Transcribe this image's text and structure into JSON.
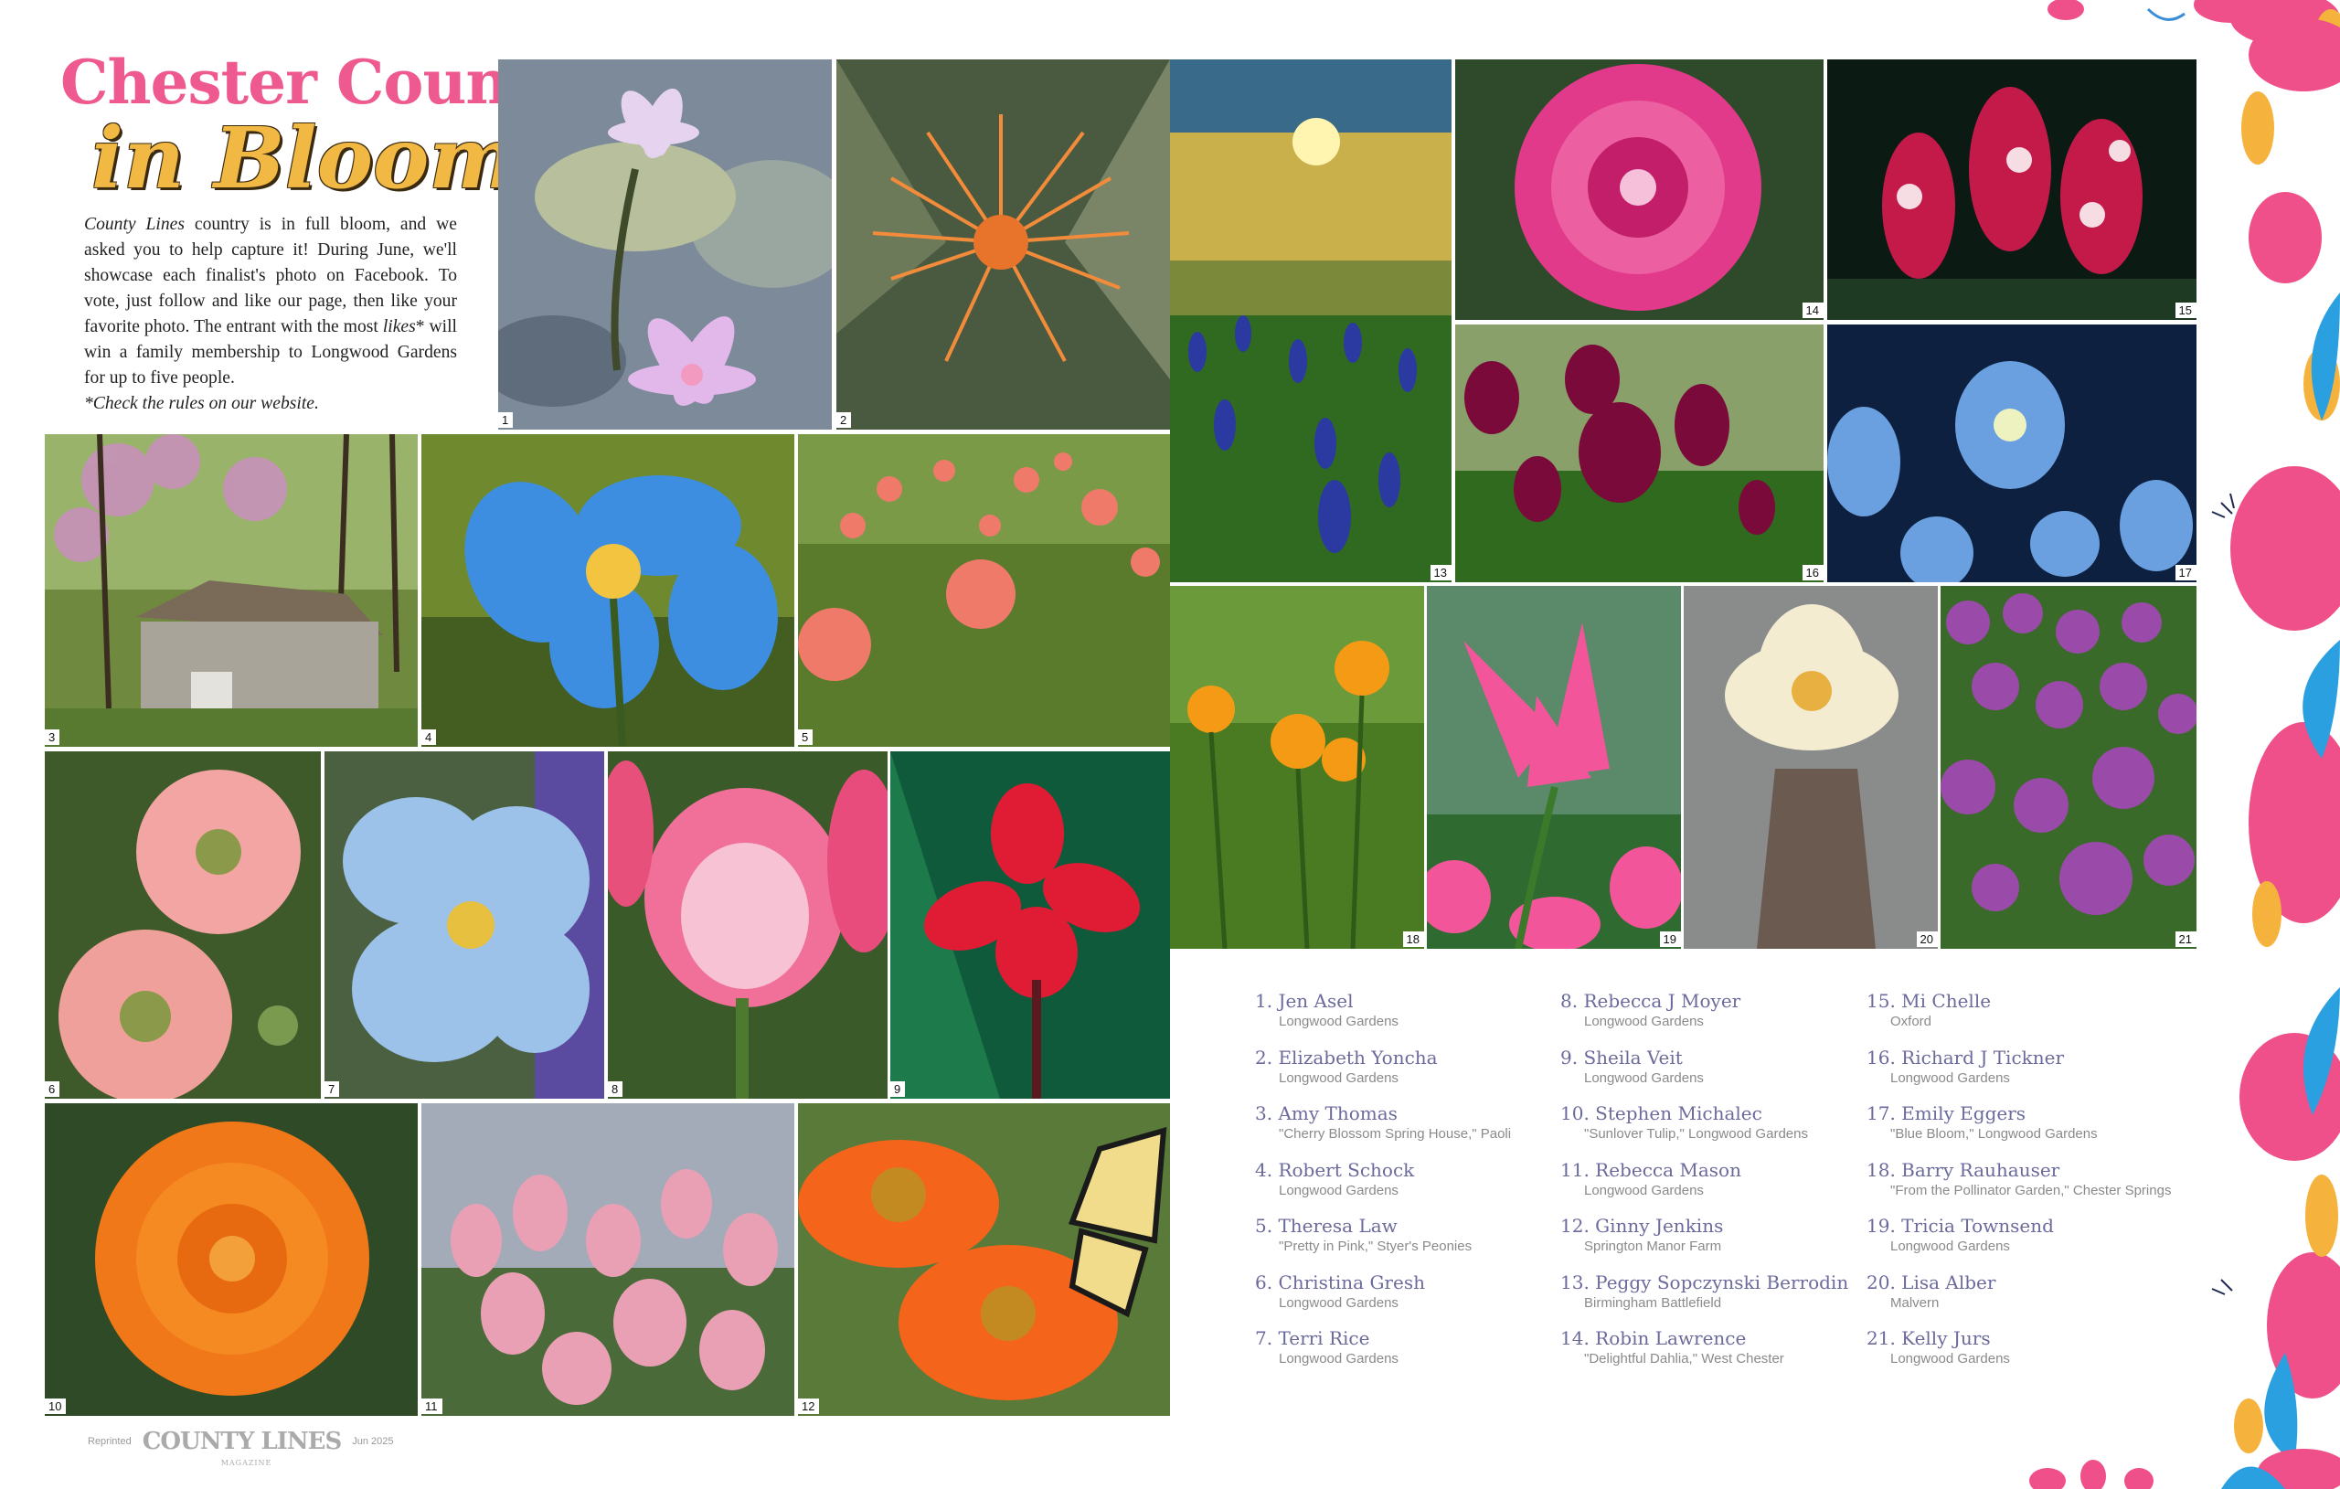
{
  "title": {
    "line1": "Chester County",
    "line2": "in Bloom"
  },
  "intro": {
    "magazine_name": "County Lines",
    "body": " country is in full bloom, and we asked you to help capture it! During June, we'll showcase each finalist's photo on Facebook. To vote, just follow and like our page, then like your favorite photo. The entrant with the most ",
    "likes_word": "likes",
    "body_end": "* will win a family membership to Longwood Gardens for up to five people.",
    "rules_note": "*Check the rules on our website."
  },
  "photos": [
    {
      "number": "1",
      "subject": "water lilies"
    },
    {
      "number": "2",
      "subject": "orange pincushion protea"
    },
    {
      "number": "3",
      "subject": "spring house with redbud trees"
    },
    {
      "number": "4",
      "subject": "blue poppy"
    },
    {
      "number": "5",
      "subject": "coral peonies"
    },
    {
      "number": "6",
      "subject": "pink poppies"
    },
    {
      "number": "7",
      "subject": "blue poppy"
    },
    {
      "number": "8",
      "subject": "fringed pink tulip"
    },
    {
      "number": "9",
      "subject": "red canna lily"
    },
    {
      "number": "10",
      "subject": "orange ranunculus"
    },
    {
      "number": "11",
      "subject": "pink tulips"
    },
    {
      "number": "12",
      "subject": "orange flowers with swallowtail butterfly"
    },
    {
      "number": "13",
      "subject": "sunflower field with grape hyacinths"
    },
    {
      "number": "14",
      "subject": "pink dahlia"
    },
    {
      "number": "15",
      "subject": "snapdragons"
    },
    {
      "number": "16",
      "subject": "burgundy tulips"
    },
    {
      "number": "17",
      "subject": "blue delphinium"
    },
    {
      "number": "18",
      "subject": "orange coreopsis"
    },
    {
      "number": "19",
      "subject": "pink lily tulip"
    },
    {
      "number": "20",
      "subject": "white dahlia over tattooed arm"
    },
    {
      "number": "21",
      "subject": "purple double tulips"
    }
  ],
  "credits": [
    [
      {
        "name": "1. Jen Asel",
        "location": "Longwood Gardens"
      },
      {
        "name": "2. Elizabeth Yoncha",
        "location": "Longwood Gardens"
      },
      {
        "name": "3. Amy Thomas",
        "location": "\"Cherry Blossom Spring House,\" Paoli"
      },
      {
        "name": "4. Robert Schock",
        "location": "Longwood Gardens"
      },
      {
        "name": "5. Theresa Law",
        "location": "\"Pretty in Pink,\" Styer's Peonies"
      },
      {
        "name": "6. Christina Gresh",
        "location": "Longwood Gardens"
      },
      {
        "name": "7. Terri Rice",
        "location": "Longwood Gardens"
      }
    ],
    [
      {
        "name": "8. Rebecca J Moyer",
        "location": "Longwood Gardens"
      },
      {
        "name": "9. Sheila Veit",
        "location": "Longwood Gardens"
      },
      {
        "name": "10. Stephen Michalec",
        "location": "\"Sunlover Tulip,\" Longwood Gardens"
      },
      {
        "name": "11. Rebecca Mason",
        "location": "Longwood Gardens"
      },
      {
        "name": "12. Ginny Jenkins",
        "location": "Springton Manor Farm"
      },
      {
        "name": "13. Peggy Sopczynski Berrodin",
        "location": "Birmingham Battlefield"
      },
      {
        "name": "14. Robin Lawrence",
        "location": "\"Delightful Dahlia,\" West Chester"
      }
    ],
    [
      {
        "name": "15. Mi Chelle",
        "location": "Oxford"
      },
      {
        "name": "16. Richard J Tickner",
        "location": "Longwood Gardens"
      },
      {
        "name": "17. Emily Eggers",
        "location": "\"Blue Bloom,\" Longwood Gardens"
      },
      {
        "name": "18. Barry Rauhauser",
        "location": "\"From the Pollinator Garden,\" Chester Springs"
      },
      {
        "name": "19. Tricia Townsend",
        "location": "Longwood Gardens"
      },
      {
        "name": "20. Lisa Alber",
        "location": "Malvern"
      },
      {
        "name": "21. Kelly Jurs",
        "location": "Longwood Gardens"
      }
    ]
  ],
  "footer": {
    "reprinted": "Reprinted",
    "magazine": "COUNTY LINES",
    "magazine_sub": "MAGAZINE",
    "issue": "Jun 2025"
  },
  "colors": {
    "title_pink": "#ee5a90",
    "title_gold": "#f1b944",
    "credit_name": "#6b6a9c",
    "credit_loc": "#8a8a8a"
  }
}
